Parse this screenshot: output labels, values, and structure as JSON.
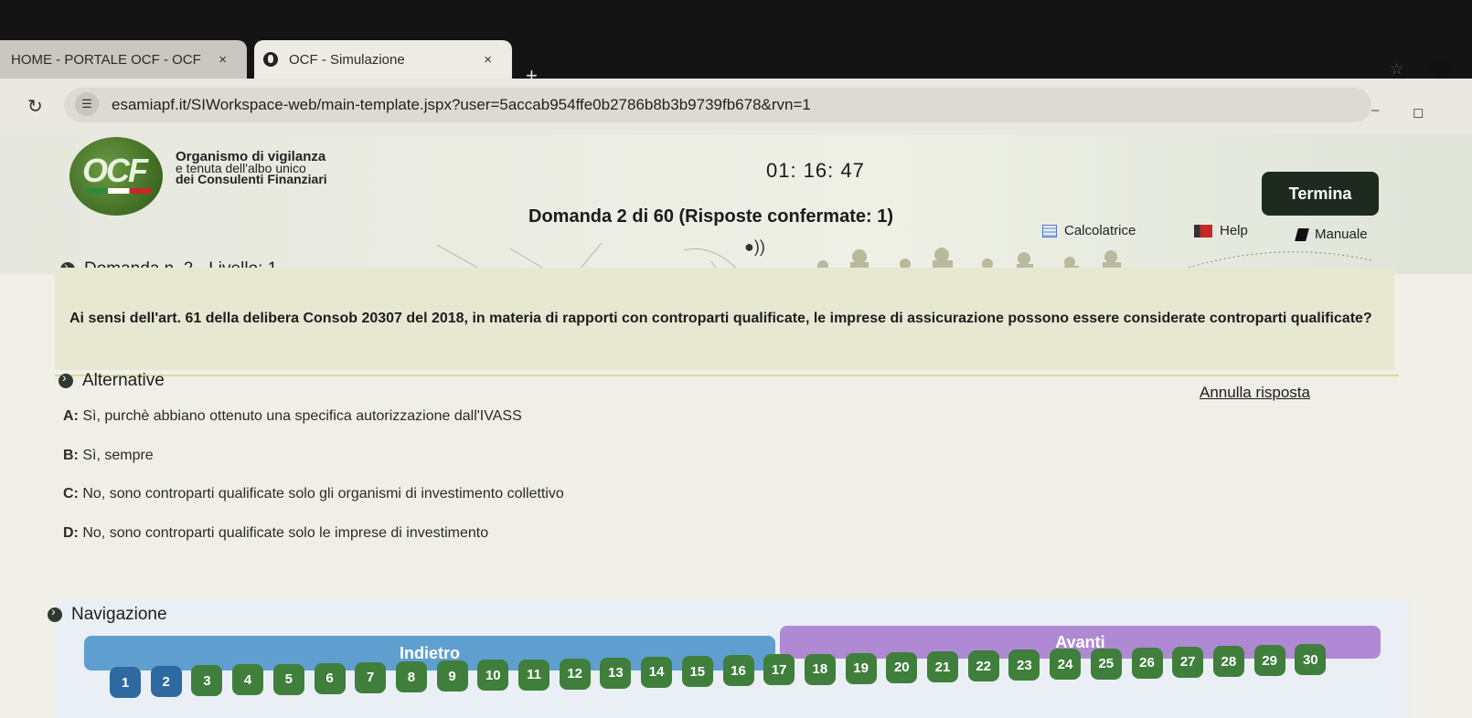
{
  "browser": {
    "tabs": [
      {
        "label": "HOME - PORTALE OCF - OCF",
        "close": "×"
      },
      {
        "label": "OCF - Simulazione",
        "close": "×"
      }
    ],
    "new_tab": "+",
    "url": "esamiapf.it/SIWorkspace-web/main-template.jspx?user=5accab954ffe0b2786b8b3b9739fb678&rvn=1"
  },
  "header": {
    "logo_text": "OCF",
    "org_line1": "Organismo di vigilanza",
    "org_line2": "e tenuta dell'albo unico",
    "org_line3": "dei Consulenti Finanziari",
    "timer": "01: 16: 47",
    "question_count": "Domanda 2 di 60 (Risposte confermate: 1)",
    "termina": "Termina",
    "tools": {
      "calc": "Calcolatrice",
      "help": "Help",
      "manual": "Manuale"
    }
  },
  "question": {
    "title": "Domanda n. 2 - Livello: 1",
    "text": "Ai sensi dell'art. 61 della delibera Consob 20307 del 2018, in materia di rapporti con controparti qualificate, le imprese di assicurazione possono essere considerate controparti qualificate?"
  },
  "alternatives": {
    "title": "Alternative",
    "reset": "Annulla risposta",
    "options": [
      {
        "key": "A:",
        "text": "Sì, purchè abbiano ottenuto una specifica autorizzazione dall'IVASS"
      },
      {
        "key": "B:",
        "text": "Sì, sempre"
      },
      {
        "key": "C:",
        "text": "No, sono controparti qualificate solo gli organismi di investimento collettivo"
      },
      {
        "key": "D:",
        "text": "No, sono controparti qualificate solo le imprese di investimento"
      }
    ]
  },
  "navigation": {
    "title": "Navigazione",
    "back": "Indietro",
    "next": "Avanti",
    "pages": [
      "1",
      "2",
      "3",
      "4",
      "5",
      "6",
      "7",
      "8",
      "9",
      "10",
      "11",
      "12",
      "13",
      "14",
      "15",
      "16",
      "17",
      "18",
      "19",
      "20",
      "21",
      "22",
      "23",
      "24",
      "25",
      "26",
      "27",
      "28",
      "29",
      "30"
    ],
    "colors": {
      "answered": "#2e6aa0",
      "current": "#2e6aa0",
      "unanswered": "#3f7f3b"
    }
  }
}
